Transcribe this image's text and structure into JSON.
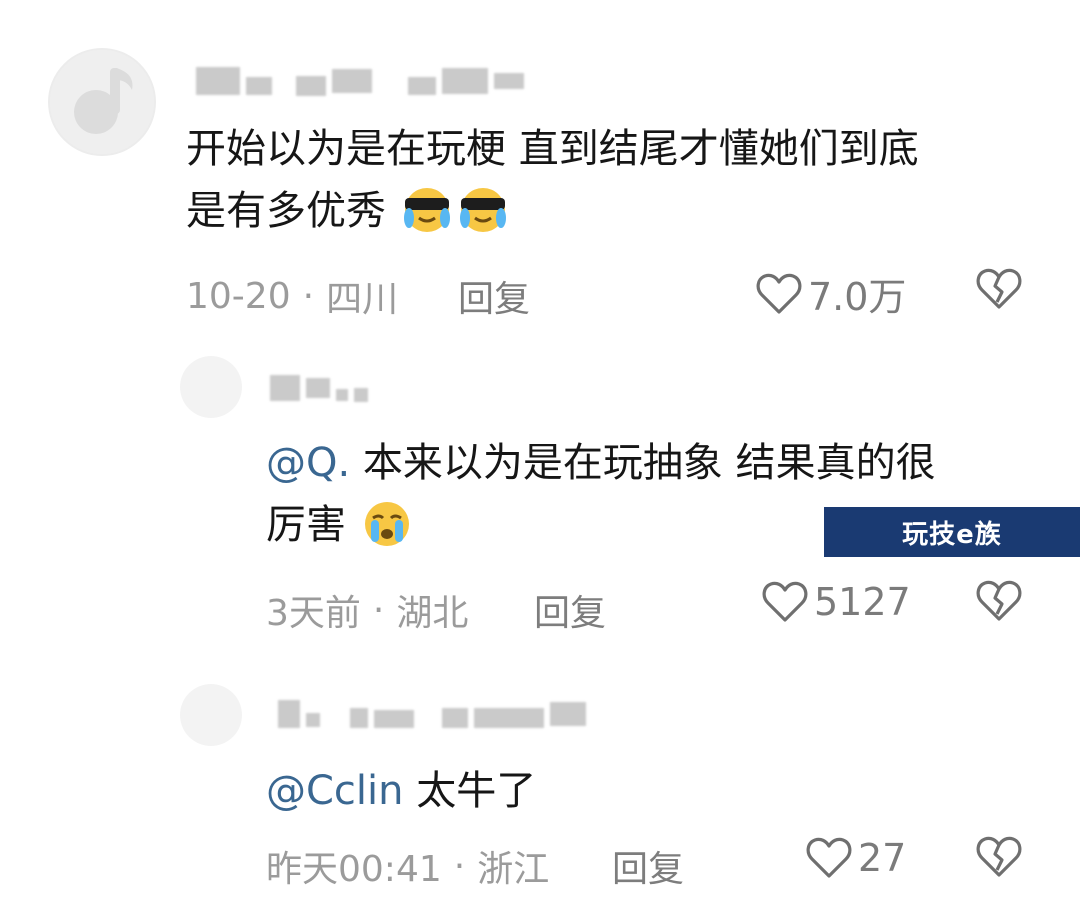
{
  "comments": [
    {
      "text": "开始以为是在玩梗 直到结尾才懂她们到底",
      "text_line2": "是有多优秀",
      "date": "10-20",
      "location": "四川",
      "reply_label": "回复",
      "likes": "7.0万"
    },
    {
      "mention": "@Q.",
      "text": " 本来以为是在玩抽象 结果真的很",
      "text_line2": "厉害",
      "date": "3天前",
      "location": "湖北",
      "reply_label": "回复",
      "likes": "5127"
    },
    {
      "mention": "@Cclin",
      "text": " 太牛了",
      "date": "昨天00:41",
      "location": "浙江",
      "reply_label": "回复",
      "likes": "27"
    }
  ],
  "separator": "·",
  "watermark": "玩技e族",
  "icons": {
    "like": "heart-outline-icon",
    "dislike": "broken-heart-icon",
    "emoji_cool": "sunglasses-tears-emoji",
    "emoji_cry": "crying-emoji"
  }
}
